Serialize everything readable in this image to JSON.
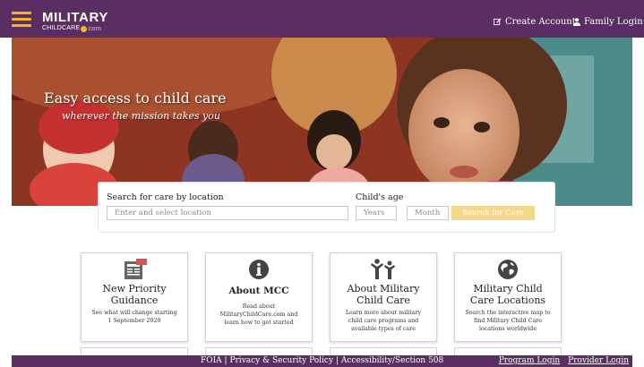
{
  "header": {
    "logo_top": "MILITARY",
    "logo_bottom_prefix": "CHILDCARE",
    "logo_bottom_suffix": "com",
    "create_account": "Create Account",
    "family_login": "Family Login"
  },
  "hero": {
    "title": "Easy access to child care",
    "subtitle": "wherever the mission takes you"
  },
  "search": {
    "location_label": "Search for care by location",
    "location_placeholder": "Enter and select location",
    "age_label": "Child's age",
    "years_placeholder": "Years",
    "months_placeholder": "Months",
    "button_label": "Search for Care"
  },
  "cards": [
    {
      "title": "New Priority Guidance",
      "description": "See what will change starting 1 September 2020",
      "icon": "newspaper-new-icon"
    },
    {
      "title": "About MCC",
      "description": "Read about MilitaryChildCare.com and learn how to get started",
      "icon": "info-circle-icon"
    },
    {
      "title": "About Military Child Care",
      "description": "Learn more about military child care programs and available types of care",
      "icon": "adult-child-icon"
    },
    {
      "title": "Military Child Care Locations",
      "description": "Search the interactive map to find Military Child Care locations worldwide",
      "icon": "globe-icon"
    }
  ],
  "footer": {
    "foia": "FOIA",
    "privacy": "Privacy & Security Policy",
    "accessibility": "Accessibility/Section 508",
    "separator": " | ",
    "program_login": "Program Login",
    "provider_login": "Provider Login"
  },
  "colors": {
    "brand_purple": "#5a2d63",
    "accent_gold": "#f3b61c",
    "button_gold": "#f6d68b"
  }
}
